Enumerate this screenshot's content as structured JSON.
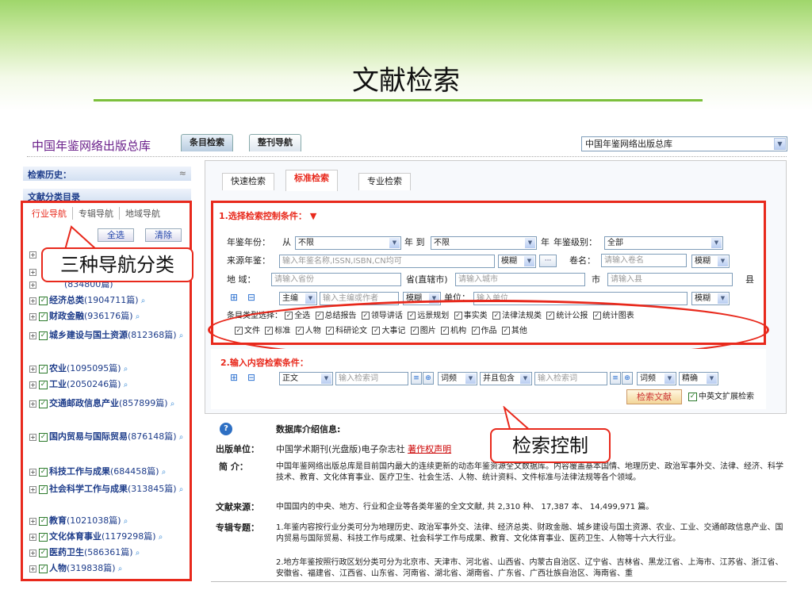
{
  "slide": {
    "title": "文献检索"
  },
  "header": {
    "brand": "中国年鉴网络出版总库",
    "tabs": [
      "条目检索",
      "整刊导航"
    ],
    "db_select": "中国年鉴网络出版总库"
  },
  "sidebar": {
    "history_label": "检索历史：",
    "catalog_label": "文献分类目录",
    "nav_tabs": [
      "行业导航",
      "专辑导航",
      "地域导航"
    ],
    "select_all": "全选",
    "clear": "清除",
    "hidden_item": "(834800篇)",
    "categories": [
      {
        "name": "经济总类",
        "count": "(1904711篇)"
      },
      {
        "name": "财政金融",
        "count": "(936176篇)"
      },
      {
        "name": "城乡建设与国土资源",
        "count": "(812368篇)"
      },
      {
        "name": "农业",
        "count": "(1095095篇)"
      },
      {
        "name": "工业",
        "count": "(2050246篇)"
      },
      {
        "name": "交通邮政信息产业",
        "count": "(857899篇)"
      },
      {
        "name": "国内贸易与国际贸易",
        "count": "(876148篇)"
      },
      {
        "name": "科技工作与成果",
        "count": "(684458篇)"
      },
      {
        "name": "社会科学工作与成果",
        "count": "(313845篇)"
      },
      {
        "name": "教育",
        "count": "(1021038篇)"
      },
      {
        "name": "文化体育事业",
        "count": "(1179298篇)"
      },
      {
        "name": "医药卫生",
        "count": "(586361篇)"
      },
      {
        "name": "人物",
        "count": "(319838篇)"
      }
    ]
  },
  "callouts": {
    "nav": "三种导航分类",
    "search": "检索控制"
  },
  "main": {
    "tabs": [
      "快速检索",
      "标准检索",
      "专业检索"
    ],
    "section1": {
      "title": "1.选择检索控制条件：",
      "year_label": "年鉴年份：",
      "from": "从",
      "year_from": "不限",
      "to": "年 到",
      "year_to": "不限",
      "year_suffix": "年",
      "level_label": "年鉴级别：",
      "level": "全部",
      "source_label": "来源年鉴：",
      "source_placeholder": "输入年鉴名称,ISSN,ISBN,CN均可",
      "fuzzy": "模糊",
      "more": "···",
      "volume_label": "卷名：",
      "volume_placeholder": "请输入卷名",
      "region_label": "地  域：",
      "province_placeholder": "请输入省份",
      "province_label": "省(直辖市)",
      "city_placeholder": "请输入城市",
      "city_label": "市",
      "county_placeholder": "请输入县",
      "county_label": "县",
      "editor_select": "主编",
      "editor_placeholder": "输入主编或作者",
      "unit_label": "单位：",
      "unit_placeholder": "输入单位",
      "types_label": "条目类型选择：",
      "types_row1": [
        "全选",
        "总结报告",
        "领导讲话",
        "远景规划",
        "事实类",
        "法律法规类",
        "统计公报",
        "统计图表"
      ],
      "types_row2": [
        "文件",
        "标准",
        "人物",
        "科研论文",
        "大事记",
        "图片",
        "机构",
        "作品",
        "其他"
      ]
    },
    "section2": {
      "title": "2.输入内容检索条件：",
      "field1": "正文",
      "kw_placeholder": "输入检索词",
      "freq": "词频",
      "logic": "并且包含",
      "freq2": "词频",
      "match": "精确",
      "search_button": "检索文献",
      "ext_label": "中英文扩展检索"
    }
  },
  "info": {
    "header": "数据库介绍信息:",
    "publisher_label": "出版单位：",
    "publisher": "中国学术期刊(光盘版)电子杂志社",
    "copyright_link": "著作权声明",
    "intro_label": "简  介：",
    "intro": "中国年鉴网络出版总库是目前国内最大的连续更新的动态年鉴资源全文数据库。内容覆盖基本国情、地理历史、政治军事外交、法律、经济、科学技术、教育、文化体育事业、医疗卫生、社会生活、人物、统计资料、文件标准与法律法规等各个领域。",
    "source_label": "文献来源：",
    "source": "中国国内的中央、地方、行业和企业等各类年鉴的全文文献, 共  2,310  种、  17,387  本、  14,499,971  篇。",
    "topics_label": "专辑专题：",
    "topic1": "1.年鉴内容按行业分类可分为地理历史、政治军事外交、法律、经济总类、财政金融、城乡建设与国土资源、农业、工业、交通邮政信息产业、国内贸易与国际贸易、科技工作与成果、社会科学工作与成果、教育、文化体育事业、医药卫生、人物等十六大行业。",
    "topic2": "2.地方年鉴按照行政区划分类可分为北京市、天津市、河北省、山西省、内蒙古自治区、辽宁省、吉林省、黑龙江省、上海市、江苏省、浙江省、安徽省、福建省、江西省、山东省、河南省、湖北省、湖南省、广东省、广西壮族自治区、海南省、重"
  },
  "colors": {
    "accent_red": "#e8291c",
    "brand_purple": "#6a1f8a",
    "link_blue": "#1d3c8a",
    "banner_green": "#9fd66b"
  }
}
